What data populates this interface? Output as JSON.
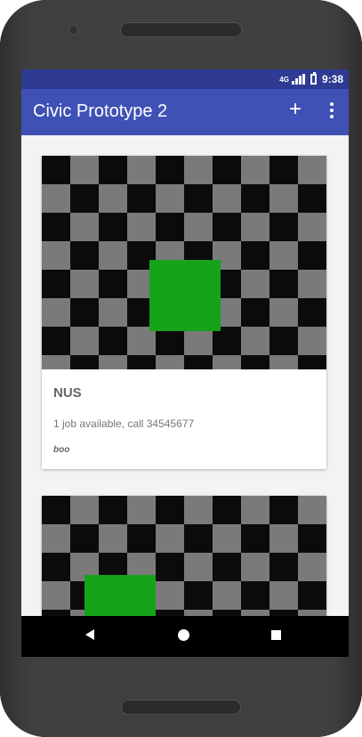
{
  "status_bar": {
    "network_label": "4G",
    "time": "9:38"
  },
  "app_bar": {
    "title": "Civic Prototype 2",
    "actions": {
      "add": "+"
    }
  },
  "cards": [
    {
      "title": "NUS",
      "description": "1 job available, call 34545677",
      "meta": "boo"
    }
  ],
  "colors": {
    "status_bar": "#2f3b92",
    "app_bar": "#3f51b5",
    "green_block": "#16a31a",
    "checker_dark": "#0b0b0b",
    "checker_light": "#7a7a7a"
  },
  "icons": {
    "add": "add-icon",
    "overflow": "more-vert-icon",
    "signal": "signal-icon",
    "battery": "battery-icon",
    "back": "back-icon",
    "home": "home-icon",
    "recents": "recents-icon"
  }
}
